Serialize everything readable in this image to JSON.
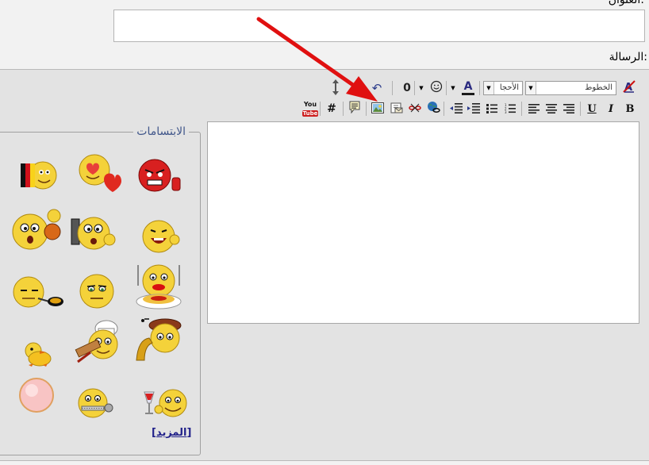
{
  "form": {
    "title_label": "العنوان:",
    "title_value": "",
    "message_label": "الرسالة:",
    "message_value": ""
  },
  "toolbar": {
    "font_select": "الخطوط",
    "size_select": "الأحجا",
    "bold": "B",
    "italic": "I",
    "underline": "U",
    "hash": "#",
    "youtube_top": "You",
    "youtube_bottom": "Tube",
    "font_color_letter": "A",
    "undo": "↶",
    "attach": "0"
  },
  "smilies": {
    "legend": "الابتسامات",
    "more": "المزيد",
    "open_bracket": "[",
    "close_bracket": "]"
  },
  "colors": {
    "arrow": "#e01010",
    "font_color_underline": "#1a1a1a",
    "legend_text": "#40568a",
    "panel_bg": "#e3e3e3"
  }
}
